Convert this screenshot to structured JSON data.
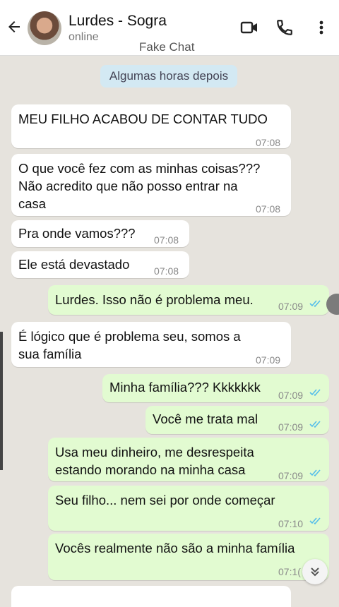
{
  "header": {
    "contact_name": "Lurdes - Sogra",
    "status": "online",
    "watermark": "Fake Chat",
    "icons": [
      "back-arrow-icon",
      "video-call-icon",
      "phone-icon",
      "more-vertical-icon"
    ]
  },
  "date_separator": "Algumas horas depois",
  "messages": [
    {
      "direction": "in",
      "text": "MEU FILHO ACABOU DE CONTAR TUDO",
      "time": "07:08"
    },
    {
      "direction": "in",
      "text": "O que você fez com as minhas coisas???\nNão acredito que não posso entrar na\ncasa",
      "time": "07:08"
    },
    {
      "direction": "in",
      "text": "Pra onde vamos???",
      "time": "07:08"
    },
    {
      "direction": "in",
      "text": "Ele está devastado",
      "time": "07:08"
    },
    {
      "direction": "out",
      "text": "Lurdes. Isso não é problema meu.",
      "time": "07:09"
    },
    {
      "direction": "in",
      "text": "É lógico que é problema seu, somos a\nsua família",
      "time": "07:09"
    },
    {
      "direction": "out",
      "text": "Minha família??? Kkkkkkk",
      "time": "07:09"
    },
    {
      "direction": "out",
      "text": "Você me trata mal",
      "time": "07:09"
    },
    {
      "direction": "out",
      "text": "Usa meu dinheiro, me desrespeita\nestando morando na minha casa",
      "time": "07:09"
    },
    {
      "direction": "out",
      "text": "Seu filho... nem sei por onde começar",
      "time": "07:10"
    },
    {
      "direction": "out",
      "text": "Vocês realmente não são a minha família",
      "time": "07:1("
    }
  ],
  "colors": {
    "incoming_bubble": "#ffffff",
    "outgoing_bubble": "#e2fbd1",
    "chat_background": "#e6e3dd",
    "read_ticks": "#53bdeb",
    "date_chip": "#d3e9f3"
  }
}
